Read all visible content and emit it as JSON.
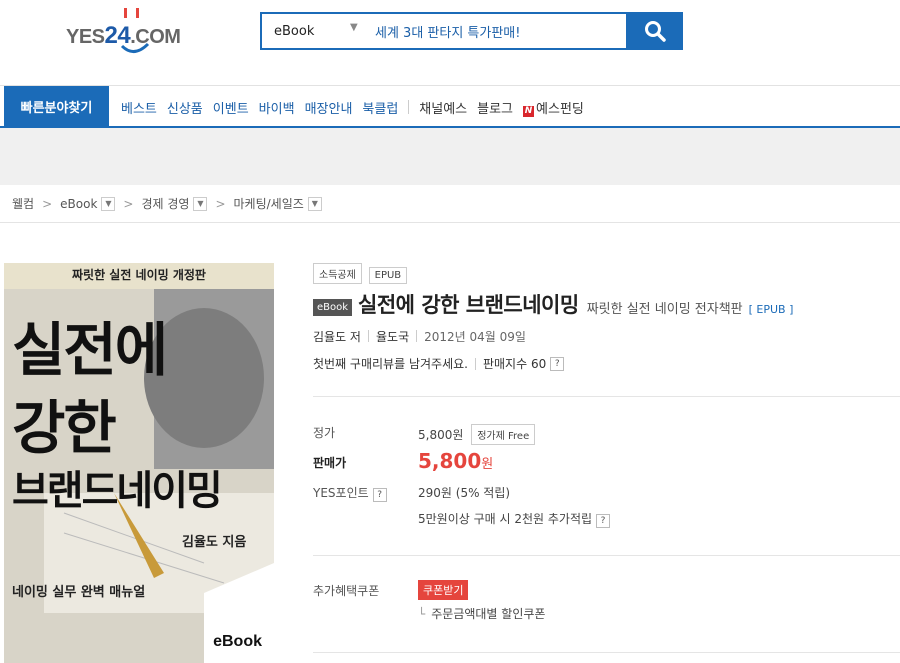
{
  "header": {
    "logo": "YES24.COM",
    "search": {
      "category": "eBook",
      "query": "세계 3대 판타지 특가판매!"
    }
  },
  "nav": {
    "quick_find": "빠른분야찾기",
    "items": [
      "베스트",
      "신상품",
      "이벤트",
      "바이백",
      "매장안내",
      "북클럽"
    ],
    "items_gray": [
      "채널예스",
      "블로그"
    ],
    "yes_funding": "예스펀딩"
  },
  "breadcrumb": [
    "웰컴",
    "eBook",
    "경제 경영",
    "마케팅/세일즈"
  ],
  "cover": {
    "top_strip": "짜릿한 실전 네이밍 개정판",
    "line1": "실전에",
    "line2": "강한",
    "line3": "브랜드네이밍",
    "author": "김율도 지음",
    "subtitle": "네이밍 실무 완벽 매뉴얼",
    "badge": "eBook"
  },
  "product": {
    "tags": [
      "소득공제",
      "EPUB"
    ],
    "ebook_badge": "eBook",
    "title": "실전에 강한 브랜드네이밍",
    "subtitle": "짜릿한 실전 네이밍 전자책판",
    "format": "[ EPUB ]",
    "author": "김율도 저",
    "publisher": "율도국",
    "date": "2012년 04월 09일",
    "review_prompt": "첫번째 구매리뷰를 남겨주세요.",
    "sales_index": "판매지수 60"
  },
  "pricing": {
    "list_label": "정가",
    "list_value": "5,800원",
    "list_badge": "정가제 Free",
    "sale_label": "판매가",
    "sale_value": "5,800",
    "sale_unit": "원",
    "points_label": "YES포인트",
    "points_value": "290원 (5% 적립)",
    "points_extra": "5만원이상 구매 시 2천원 추가적립",
    "coupon_label": "추가혜택쿠폰",
    "coupon_button": "쿠폰받기",
    "coupon_item": "주문금액대별 할인쿠폰"
  },
  "colors": {
    "brand_blue": "#1b6bb8",
    "price_red": "#e5453d"
  }
}
